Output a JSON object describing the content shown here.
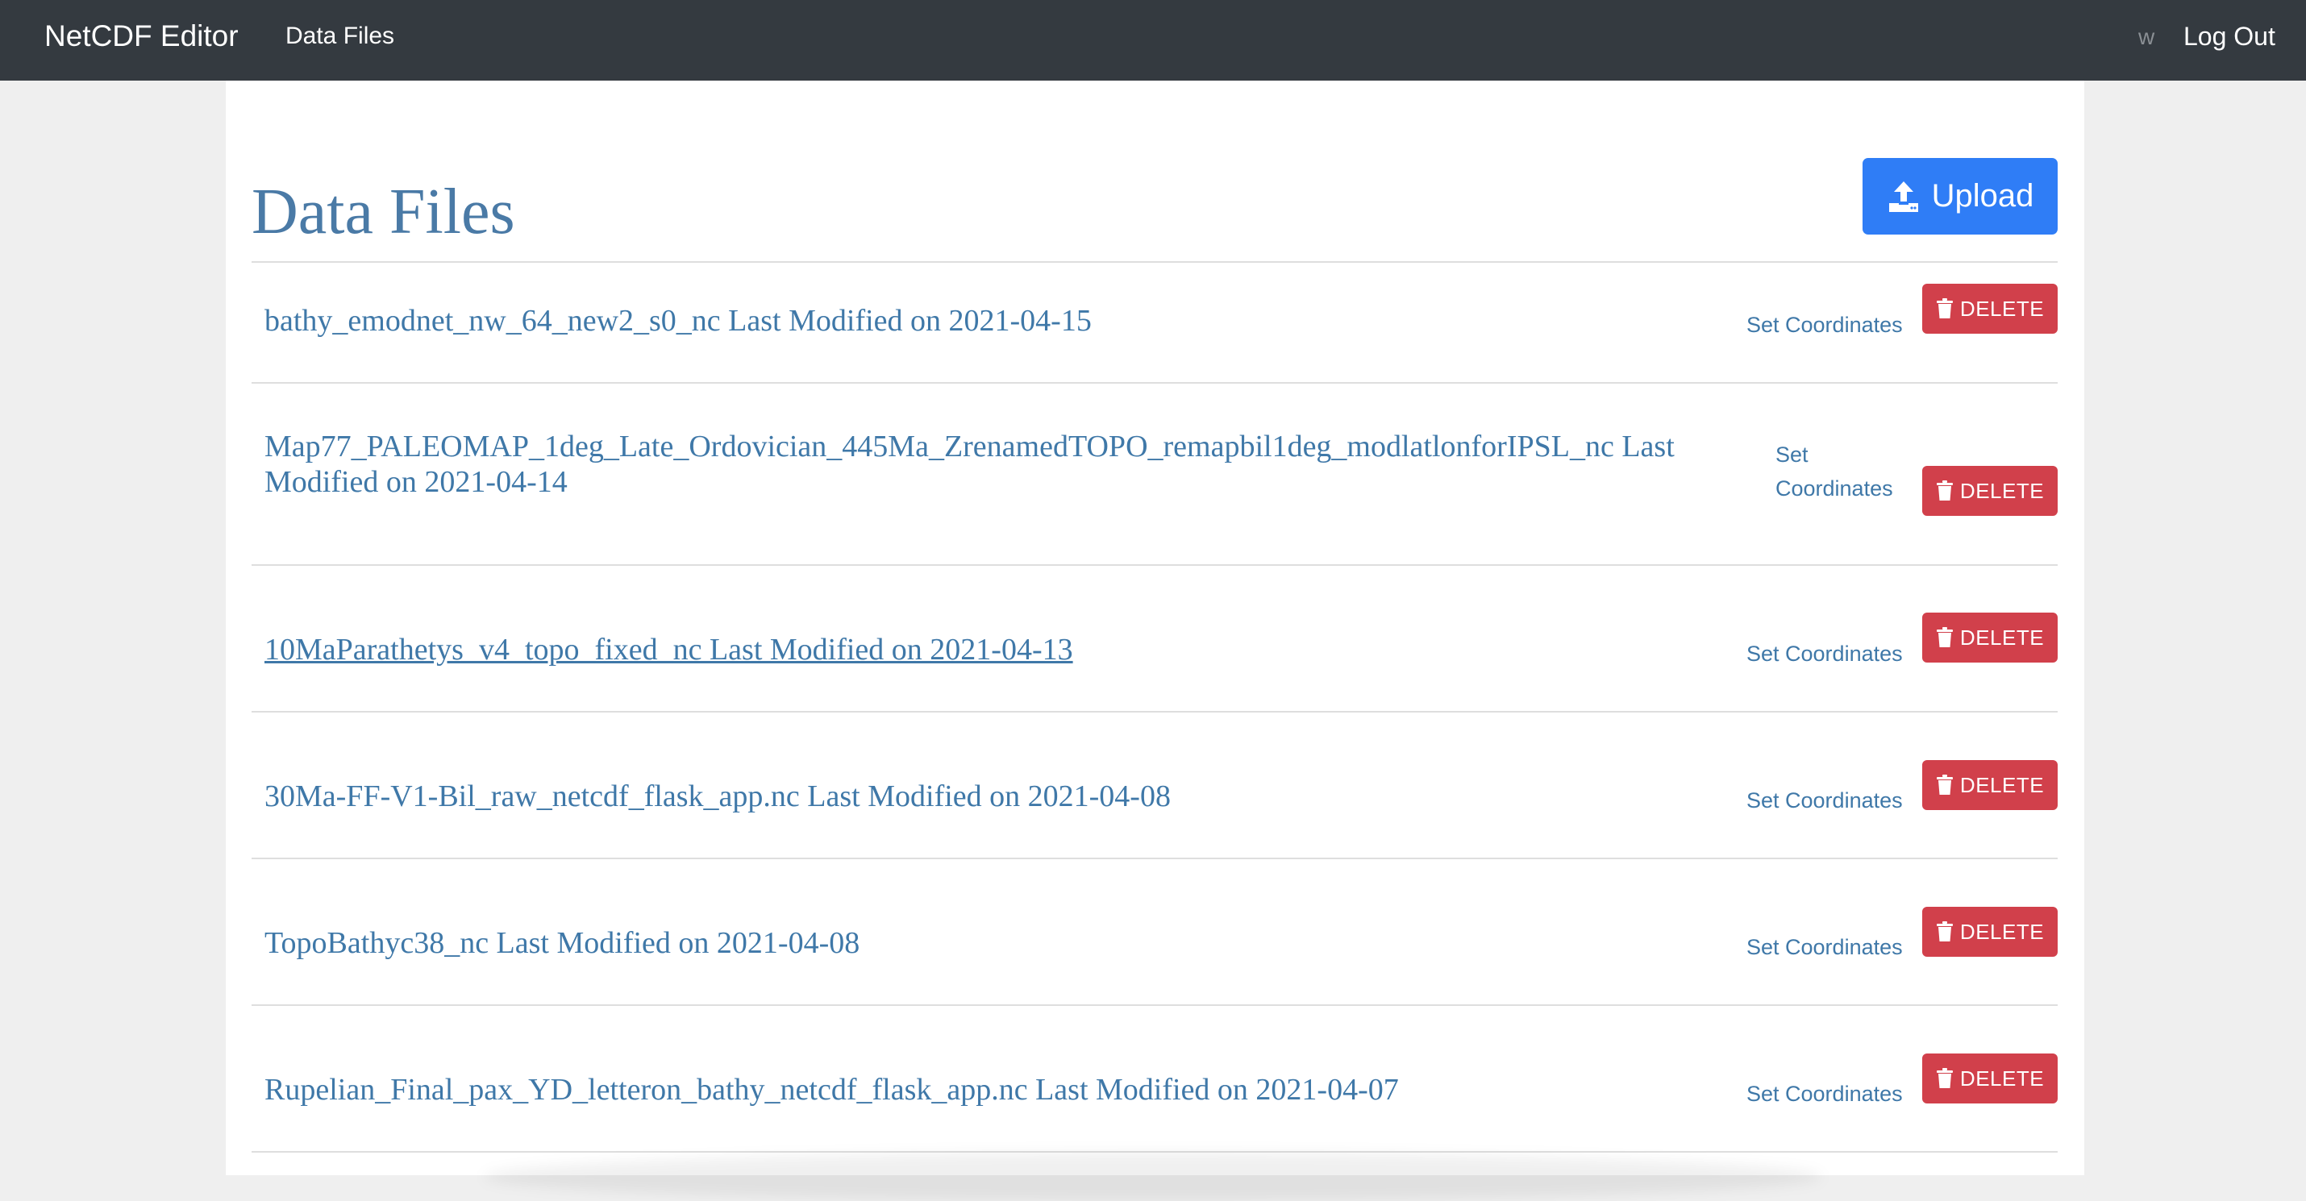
{
  "navbar": {
    "brand": "NetCDF Editor",
    "link_data_files": "Data Files",
    "user": "w",
    "logout": "Log Out"
  },
  "main": {
    "title": "Data Files",
    "upload_label": "Upload",
    "set_coordinates_label": "Set Coordinates",
    "set_label": "Set",
    "coordinates_label": "Coordinates",
    "delete_label": "DELETE",
    "files": [
      {
        "text": "bathy_emodnet_nw_64_new2_s0_nc Last Modified on 2021-04-15"
      },
      {
        "text": "Map77_PALEOMAP_1deg_Late_Ordovician_445Ma_ZrenamedTOPO_remapbil1deg_modlatlonforIPSL_nc Last",
        "text_line2": "Modified on 2021-04-14"
      },
      {
        "text": "10MaParathetys_v4_topo_fixed_nc Last Modified on 2021-04-13"
      },
      {
        "text": "30Ma-FF-V1-Bil_raw_netcdf_flask_app.nc Last Modified on 2021-04-08"
      },
      {
        "text": "TopoBathyc38_nc Last Modified on 2021-04-08"
      },
      {
        "text": "Rupelian_Final_pax_YD_letteron_bathy_netcdf_flask_app.nc Last Modified on 2021-04-07"
      }
    ]
  },
  "colors": {
    "navbar_bg": "#343a40",
    "link": "#3f78a8",
    "upload_bg": "#2f7df6",
    "delete_bg": "#d1404b"
  },
  "icons": {
    "upload": "upload-icon",
    "delete": "trash-icon"
  }
}
